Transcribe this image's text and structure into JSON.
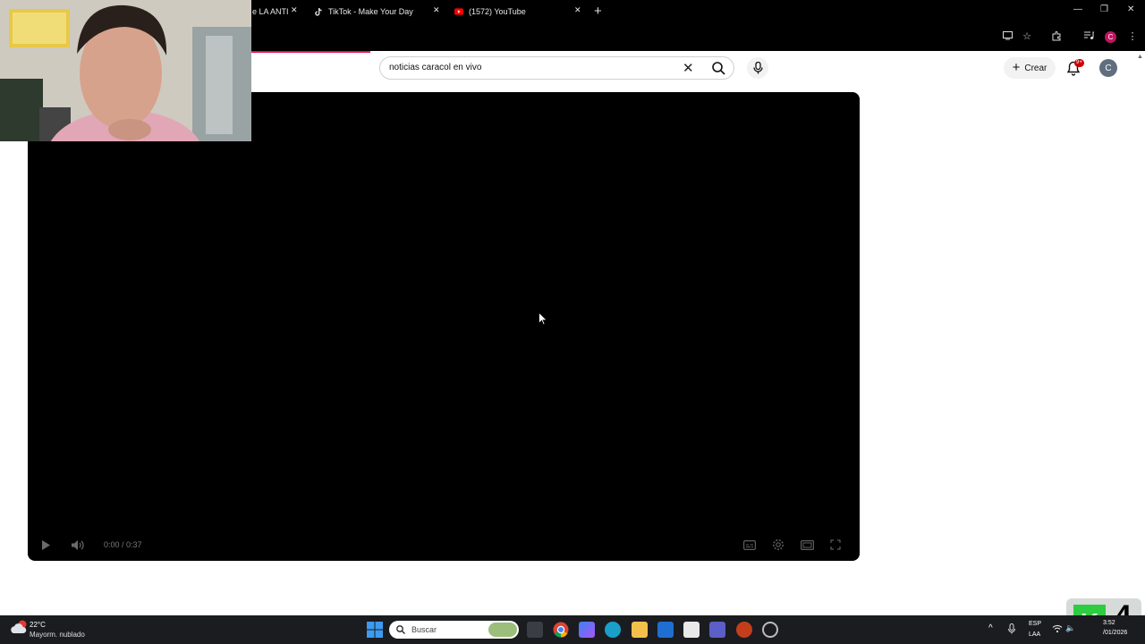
{
  "tabs": [
    {
      "title": "e LA ANTI"
    },
    {
      "title": "TikTok - Make Your Day"
    },
    {
      "title": "(1572) YouTube"
    }
  ],
  "search": {
    "query": "noticias caracol en vivo"
  },
  "masthead": {
    "create_label": "Crear",
    "notification_badge": "9+",
    "avatar_letter": "C"
  },
  "browser": {
    "profile_letter": "C"
  },
  "player": {
    "time": "0:00 / 0:37"
  },
  "taskbar": {
    "weather_temp": "22°C",
    "weather_desc": "Mayorm. nublado",
    "search_placeholder": "Buscar",
    "lang_top": "ESP",
    "lang_bottom": "LAA",
    "clock_time": "3:52",
    "clock_date": "/01/2026"
  },
  "watermark": {
    "letter": "K",
    "number": "4"
  },
  "colors": {
    "accent": "#e5174f",
    "youtube_red": "#ff0000",
    "profile": "#c1155f"
  }
}
